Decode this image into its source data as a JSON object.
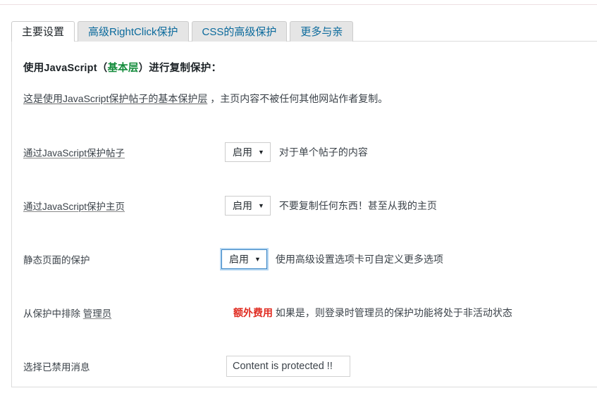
{
  "tabs": [
    {
      "label": "主要设置",
      "active": true
    },
    {
      "label": "高级RightClick保护",
      "active": false
    },
    {
      "label": "CSS的高级保护",
      "active": false
    },
    {
      "label": "更多与亲",
      "active": false
    }
  ],
  "section": {
    "title_prefix": "使用JavaScript（",
    "title_green": "基本层",
    "title_suffix": "）进行复制保护：",
    "desc_underlined": "这是使用JavaScript保护帖子的基本保护层",
    "desc_rest": " ，主页内容不被任何其他网站作者复制。"
  },
  "rows": [
    {
      "label_underlined": "通过JavaScript保护帖子",
      "label_plain": "",
      "control": "select",
      "value": "启用",
      "caret": "▼",
      "hint": "对于单个帖子的内容",
      "focused": false
    },
    {
      "label_underlined": "通过JavaScript保护主页",
      "label_plain": "",
      "control": "select",
      "value": "启用",
      "caret": "▼",
      "hint": "不要复制任何东西！甚至从我的主页",
      "focused": false
    },
    {
      "label_underlined": "",
      "label_plain": "静态页面的保护",
      "control": "select",
      "value": "启用",
      "caret": "▼",
      "hint": "使用高级设置选项卡可自定义更多选项",
      "focused": true
    },
    {
      "label_underlined": "管理员",
      "label_plain": "从保护中排除 ",
      "control": "note",
      "note_red": "额外费用",
      "note_rest": " 如果是，则登录时管理员的保护功能将处于非活动状态"
    },
    {
      "label_underlined": "",
      "label_plain": "选择已禁用消息",
      "control": "text",
      "value": "Content is protected !!",
      "placeholder": ""
    }
  ],
  "colors": {
    "tab_link": "#0b6a9c",
    "tab_active_bg": "#ffffff",
    "tab_inactive_bg": "#e5e5e5",
    "accent_green": "#148c3c",
    "accent_red": "#e02b20",
    "focus_blue": "#3582c4",
    "panel_border": "#dcdcdc"
  }
}
